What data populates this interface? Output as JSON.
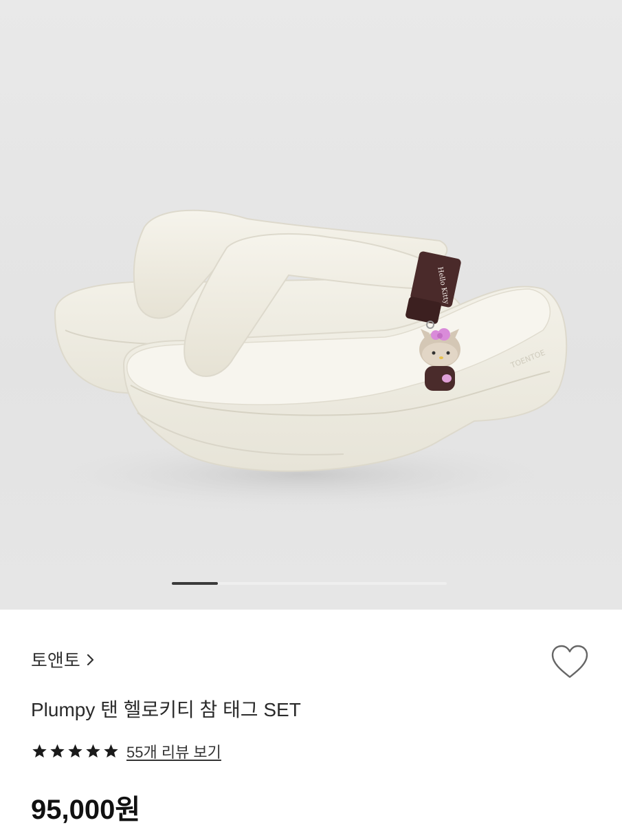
{
  "product": {
    "brand": "토앤토",
    "title": "Plumpy 탠 헬로키티 참 태그 SET",
    "rating_stars": 5,
    "review_link": "55개 리뷰 보기",
    "price": "95,000원",
    "tag_text": "Hello Kitty"
  },
  "gallery": {
    "current_slide": 1,
    "total_slides": 6
  },
  "colors": {
    "background": "#e6e6e6",
    "sandal": "#f2f0e6",
    "tag": "#4a2a2a",
    "charm_bow": "#d98bd9"
  },
  "icons": {
    "brand_chevron": "chevron-right-icon",
    "wishlist": "heart-outline-icon",
    "star": "star-filled-icon"
  }
}
